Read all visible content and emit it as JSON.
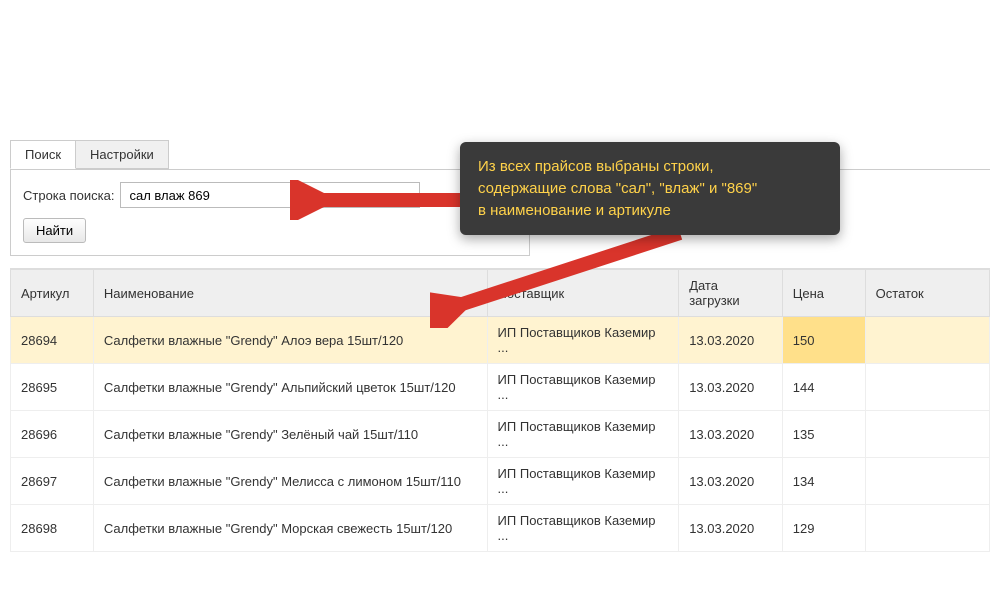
{
  "tabs": {
    "search": "Поиск",
    "settings": "Настройки"
  },
  "search": {
    "label": "Строка поиска:",
    "value": "сал влаж 869",
    "find_button": "Найти"
  },
  "callout": {
    "line1": "Из всех прайсов выбраны строки,",
    "line2": "содержащие слова \"сал\", \"влаж\" и \"869\"",
    "line3": "в наименование и артикуле"
  },
  "table": {
    "headers": {
      "article": "Артикул",
      "name": "Наименование",
      "supplier": "Поставщик",
      "date": "Дата загрузки",
      "price": "Цена",
      "stock": "Остаток"
    },
    "rows": [
      {
        "article": "28694",
        "name": "Салфетки влажные \"Grendy\" Алоэ вера 15шт/120",
        "supplier": "ИП Поставщиков Каземир ...",
        "date": "13.03.2020",
        "price": "150",
        "stock": "",
        "highlight": true
      },
      {
        "article": "28695",
        "name": "Салфетки влажные \"Grendy\" Альпийский цветок 15шт/120",
        "supplier": "ИП Поставщиков Каземир ...",
        "date": "13.03.2020",
        "price": "144",
        "stock": ""
      },
      {
        "article": "28696",
        "name": "Салфетки влажные \"Grendy\" Зелёный чай 15шт/110",
        "supplier": "ИП Поставщиков Каземир ...",
        "date": "13.03.2020",
        "price": "135",
        "stock": ""
      },
      {
        "article": "28697",
        "name": "Салфетки влажные \"Grendy\" Мелисса с лимоном 15шт/110",
        "supplier": "ИП Поставщиков Каземир ...",
        "date": "13.03.2020",
        "price": "134",
        "stock": ""
      },
      {
        "article": "28698",
        "name": "Салфетки влажные \"Grendy\" Морская свежесть 15шт/120",
        "supplier": "ИП Поставщиков Каземир ...",
        "date": "13.03.2020",
        "price": "129",
        "stock": ""
      }
    ]
  }
}
